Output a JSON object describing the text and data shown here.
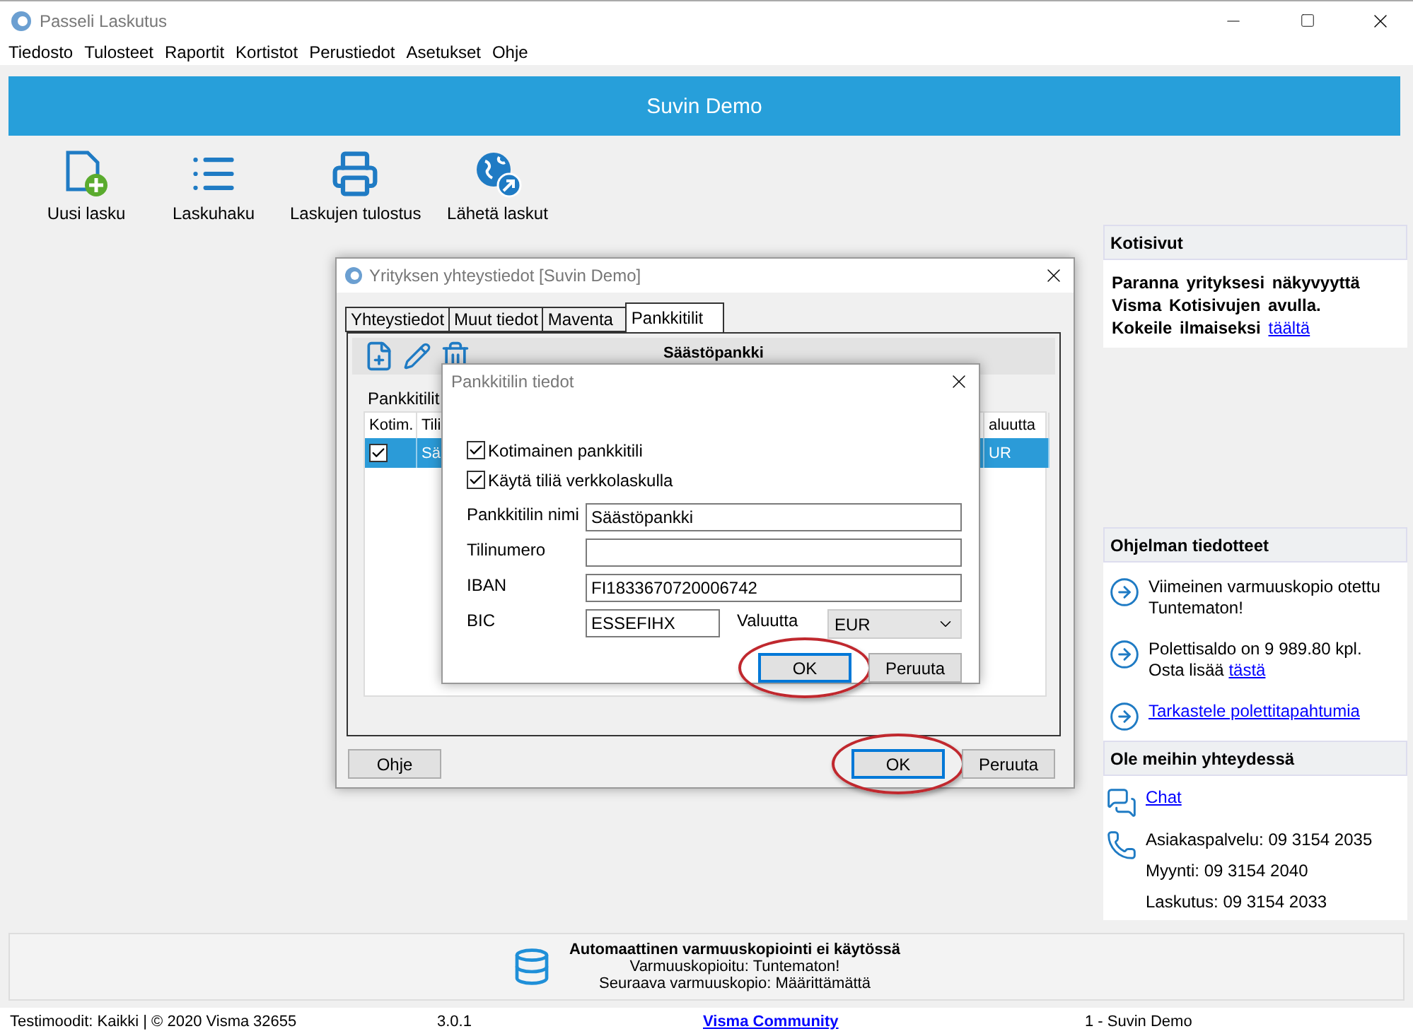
{
  "app": {
    "title": "Passeli Laskutus"
  },
  "menu": [
    "Tiedosto",
    "Tulosteet",
    "Raportit",
    "Kortistot",
    "Perustiedot",
    "Asetukset",
    "Ohje"
  ],
  "header": {
    "title": "Suvin Demo"
  },
  "toolbar": [
    {
      "label": "Uusi lasku",
      "kind": "new"
    },
    {
      "label": "Laskuhaku",
      "kind": "list"
    },
    {
      "label": "Laskujen tulostus",
      "kind": "print"
    },
    {
      "label": "Lähetä laskut",
      "kind": "send"
    }
  ],
  "side_panel": {
    "home_pages": {
      "title": "Kotisivut",
      "lines": [
        "Paranna yrityksesi näkyvyyttä",
        "Visma Kotisivujen avulla.",
        "Kokeile ilmaiseksi"
      ],
      "link": "täältä"
    },
    "notices": {
      "title": "Ohjelman tiedotteet",
      "items": [
        {
          "text": "Viimeinen varmuuskopio otettu Tuntematon!"
        },
        {
          "text": "Polettisaldo on 9 989.80 kpl. Osta lisää",
          "link": "tästä"
        },
        {
          "link": "Tarkastele polettitapahtumia"
        }
      ]
    },
    "contact": {
      "title": "Ole meihin yhteydessä",
      "chat": "Chat",
      "phones": [
        "Asiakaspalvelu: 09 3154 2035",
        "Myynti: 09 3154 2040",
        "Laskutus: 09 3154 2033"
      ]
    }
  },
  "backup": {
    "title": "Automaattinen varmuuskopiointi ei käytössä",
    "lines": [
      "Varmuuskopioitu: Tuntematon!",
      "Seuraava varmuuskopio: Määrittämättä"
    ]
  },
  "status_bar": {
    "mode": "Testimoodit: Kaikki | © 2020 Visma",
    "number": "32655",
    "version": "3.0.1",
    "link": "Visma Community",
    "company": "1 - Suvin Demo"
  },
  "company_dialog": {
    "title": "Yrityksen yhteystiedot [Suvin Demo]",
    "tabs": [
      {
        "label": "Yhteystiedot",
        "selected": false
      },
      {
        "label": "Muut tiedot",
        "selected": false
      },
      {
        "label": "Maventa",
        "selected": false
      },
      {
        "label": "Pankkitilit",
        "selected": true
      }
    ],
    "toolbar_title": "Säästöpankki",
    "list_label": "Pankkitilit",
    "table": {
      "columns": [
        "Kotim.",
        "Tili",
        "aluutta"
      ],
      "rows": [
        {
          "checked": true,
          "selected": true,
          "cells": [
            "",
            "Sä",
            "UR"
          ]
        }
      ]
    },
    "buttons": [
      {
        "label": "Ohje",
        "circled": false
      },
      {
        "label": "OK",
        "circled": true
      },
      {
        "label": "Peruuta",
        "circled": false
      }
    ]
  },
  "bank_dialog": {
    "title": "Pankkitilin tiedot",
    "options": [
      {
        "label": "Kotimainen pankkitili",
        "checked": true
      },
      {
        "label": "Käytä tiliä verkkolaskulla",
        "checked": true
      }
    ],
    "fields": [
      {
        "label": "Pankkitilin nimi",
        "value": "Säästöpankki"
      },
      {
        "label": "Tilinumero"
      },
      {
        "label": "IBAN",
        "value": "FI1833670720006742"
      }
    ],
    "bic": {
      "label": "BIC",
      "value": "ESSEFIHX"
    },
    "currency": {
      "label": "Valuutta",
      "value": "EUR"
    },
    "buttons": [
      {
        "label": "OK",
        "circled": true
      },
      {
        "label": "Peruuta",
        "circled": false
      }
    ]
  }
}
